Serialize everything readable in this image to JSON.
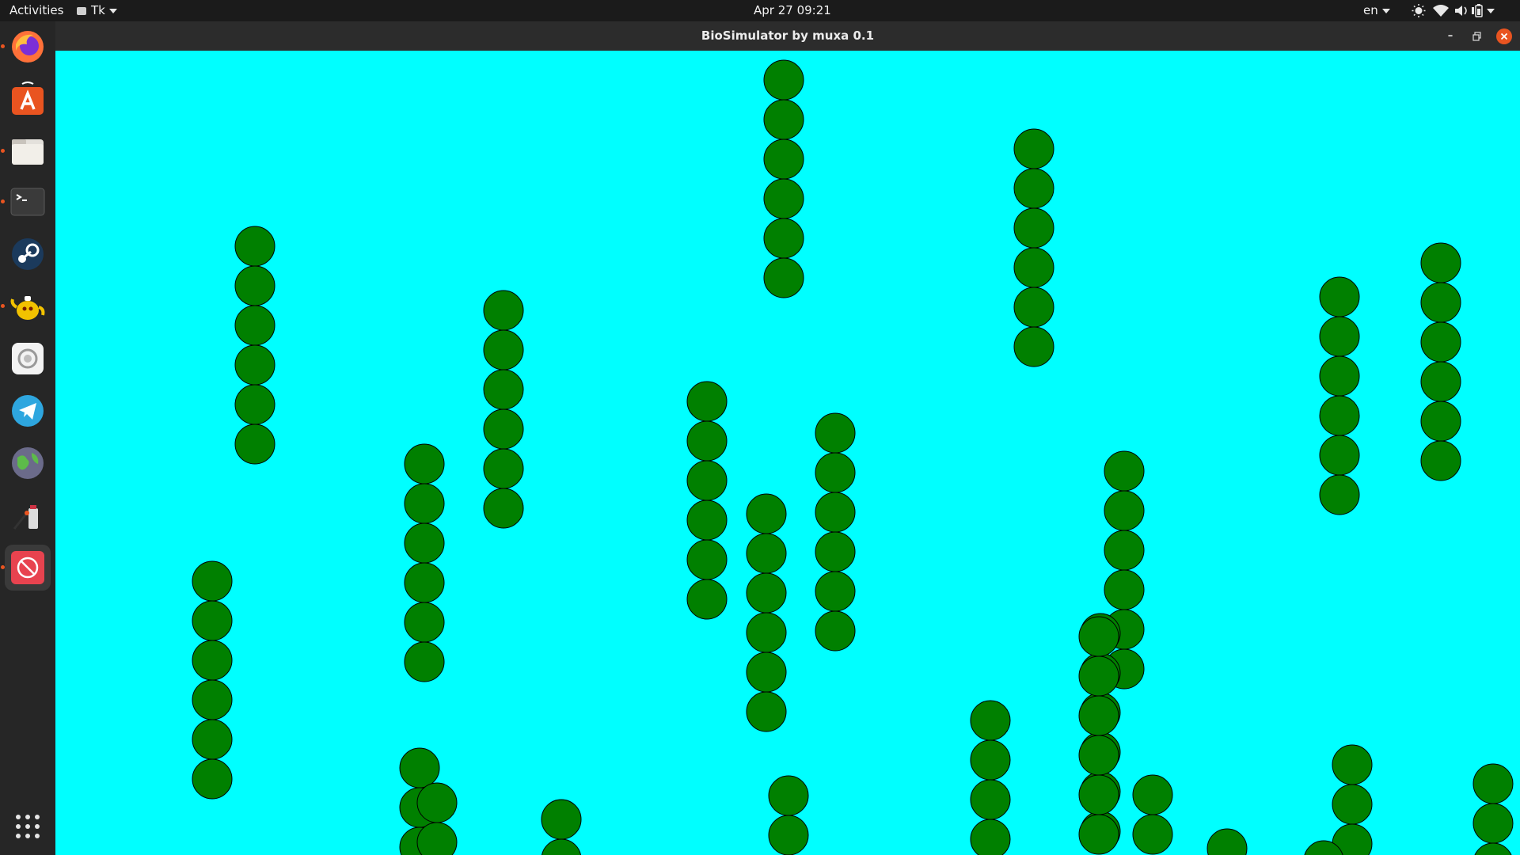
{
  "topbar": {
    "activities_label": "Activities",
    "app_menu_label": "Tk",
    "clock": "Apr 27  09:21",
    "language": "en"
  },
  "window": {
    "title": "BioSimulator by muxa 0.1"
  },
  "dock": {
    "items": [
      {
        "name": "firefox",
        "running": true
      },
      {
        "name": "ubuntu-software",
        "running": false
      },
      {
        "name": "files",
        "running": true
      },
      {
        "name": "terminal",
        "running": true
      },
      {
        "name": "steam",
        "running": false
      },
      {
        "name": "teapot-app",
        "running": true
      },
      {
        "name": "settings",
        "running": false
      },
      {
        "name": "telegram",
        "running": false
      },
      {
        "name": "globe-app",
        "running": false
      },
      {
        "name": "drawing-app",
        "running": false
      },
      {
        "name": "tk-app",
        "running": true,
        "active": true
      }
    ],
    "show_apps_icon": "grid-icon"
  },
  "simulation": {
    "background_color": "#00ffff",
    "organism_color": "#008000",
    "organism_outline": "#000000"
  }
}
